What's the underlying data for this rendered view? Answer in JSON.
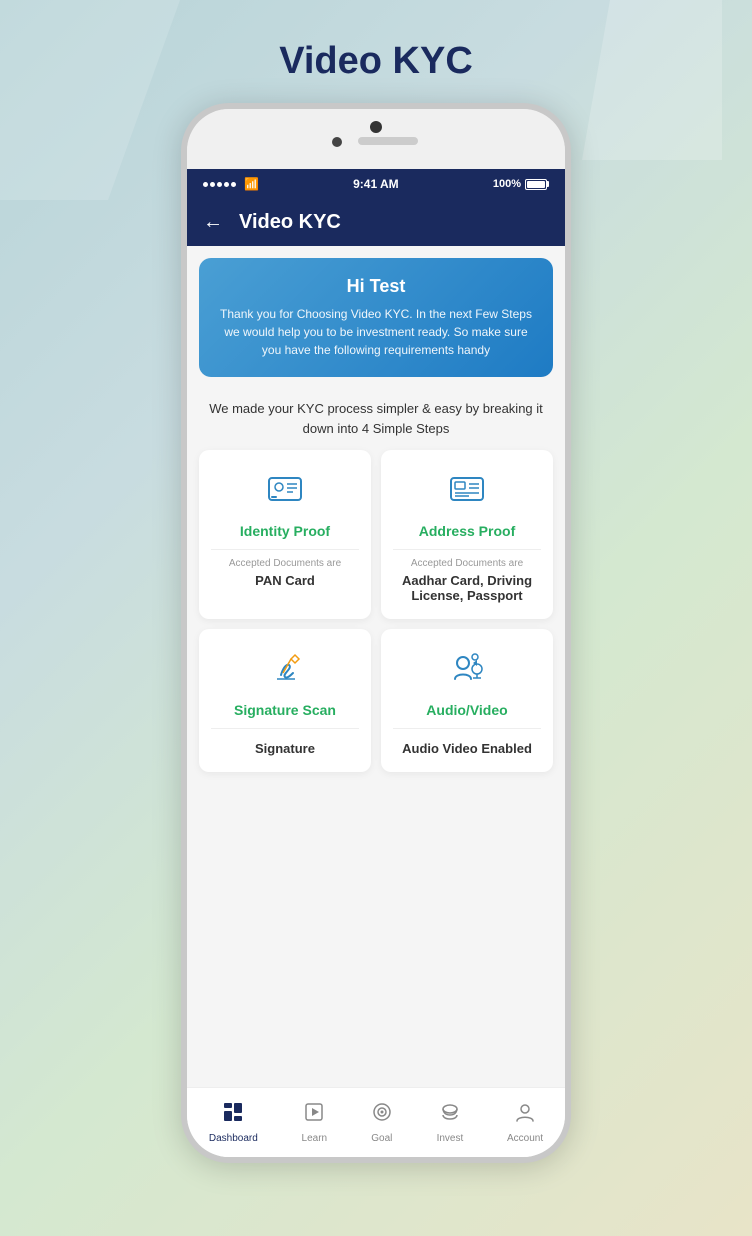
{
  "page": {
    "title": "Video KYC"
  },
  "header": {
    "back_label": "←",
    "title": "Video KYC"
  },
  "status_bar": {
    "time": "9:41 AM",
    "battery": "100%"
  },
  "banner": {
    "greeting": "Hi Test",
    "message": "Thank you for Choosing Video KYC. In the next Few Steps we would help you to be investment ready. So make sure you have the following requirements handy"
  },
  "steps_intro": "We made your KYC process simpler & easy by breaking it down into 4 Simple Steps",
  "cards": [
    {
      "id": "identity",
      "title": "Identity Proof",
      "docs_label": "Accepted Documents are",
      "docs_value": "PAN Card"
    },
    {
      "id": "address",
      "title": "Address Proof",
      "docs_label": "Accepted Documents are",
      "docs_value": "Aadhar Card, Driving License, Passport"
    },
    {
      "id": "signature",
      "title": "Signature Scan",
      "docs_label": "",
      "docs_value": "Signature"
    },
    {
      "id": "audio",
      "title": "Audio/Video",
      "docs_label": "",
      "docs_value": "Audio Video Enabled"
    }
  ],
  "bottom_nav": [
    {
      "id": "dashboard",
      "label": "Dashboard",
      "active": true
    },
    {
      "id": "learn",
      "label": "Learn",
      "active": false
    },
    {
      "id": "goal",
      "label": "Goal",
      "active": false
    },
    {
      "id": "invest",
      "label": "Invest",
      "active": false
    },
    {
      "id": "account",
      "label": "Account",
      "active": false
    }
  ]
}
